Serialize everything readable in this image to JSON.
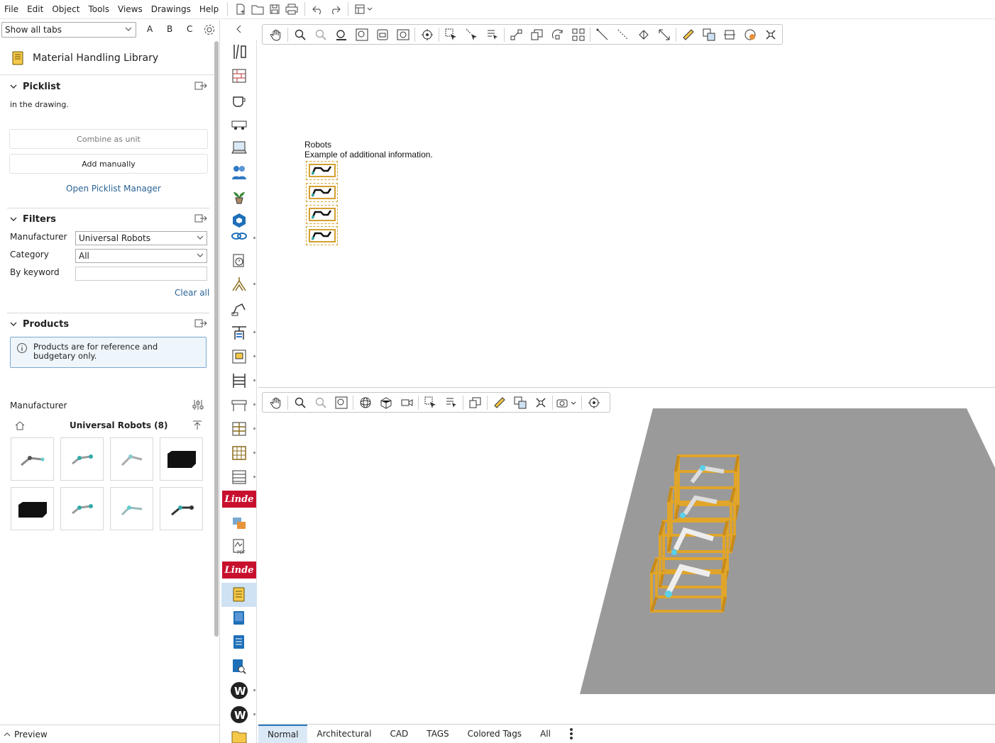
{
  "menu": [
    "File",
    "Edit",
    "Object",
    "Tools",
    "Views",
    "Drawings",
    "Help"
  ],
  "tab_select": "Show all tabs",
  "abc": [
    "A",
    "B",
    "C"
  ],
  "library_title": "Material Handling Library",
  "picklist": {
    "title": "Picklist",
    "text": "in the drawing.",
    "combine": "Combine as unit",
    "add": "Add manually",
    "open": "Open Picklist Manager"
  },
  "filters": {
    "title": "Filters",
    "manufacturer_label": "Manufacturer",
    "manufacturer_value": "Universal Robots",
    "category_label": "Category",
    "category_value": "All",
    "keyword_label": "By keyword",
    "keyword_value": "",
    "clear": "Clear all"
  },
  "products": {
    "title": "Products",
    "info": "Products are for reference and budgetary only.",
    "manufacturer_label": "Manufacturer",
    "group_title": "Universal Robots (8)"
  },
  "preview": "Preview",
  "drawing": {
    "title": "Robots",
    "subtitle": "Example of additional information."
  },
  "vendor_logo": "Linde",
  "bottom_tabs": [
    "Normal",
    "Architectural",
    "CAD",
    "TAGS",
    "Colored Tags",
    "All"
  ],
  "active_tab": "Normal",
  "colors": {
    "accent": "#2f78c4",
    "frame": "#e0a52a",
    "floor": "#9a9a9a",
    "linde": "#c8102e"
  }
}
